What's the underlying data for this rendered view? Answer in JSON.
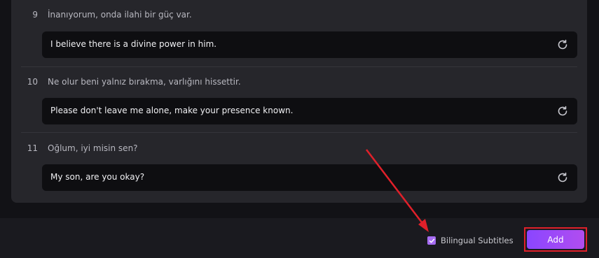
{
  "subtitles": [
    {
      "index": "9",
      "source": "İnanıyorum, onda ilahi bir güç var.",
      "translation": "I believe there is a divine power in him."
    },
    {
      "index": "10",
      "source": "Ne olur beni yalnız bırakma, varlığını hissettir.",
      "translation": "Please don't leave me alone, make your presence known."
    },
    {
      "index": "11",
      "source": "Oğlum, iyi misin sen?",
      "translation": "My son, are you okay?"
    }
  ],
  "footer": {
    "bilingual_label": "Bilingual Subtitles",
    "bilingual_checked": true,
    "add_label": "Add"
  },
  "icons": {
    "refresh": "refresh-icon",
    "check": "checkmark-icon"
  },
  "colors": {
    "accent": "#9a4cf5",
    "highlight": "#e0202a"
  }
}
